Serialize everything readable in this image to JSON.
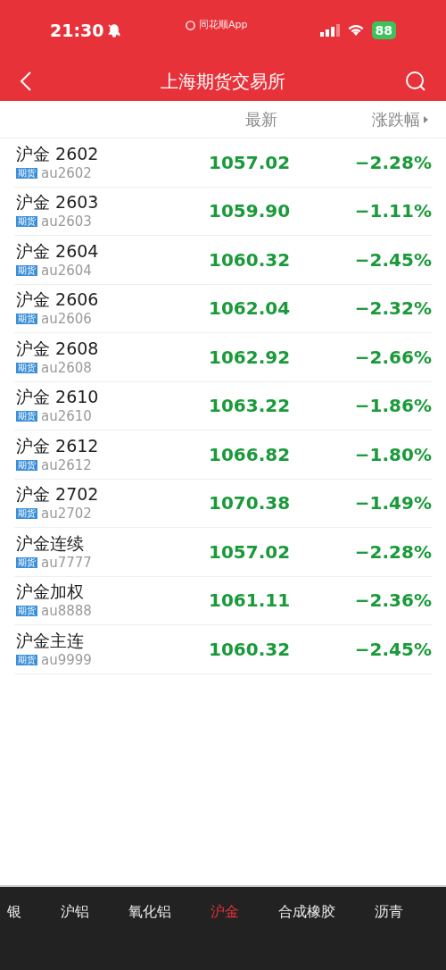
{
  "status_bar": {
    "time": "21:30",
    "app_label": "同花顺App",
    "battery": "88"
  },
  "nav": {
    "title": "上海期货交易所"
  },
  "columns": {
    "latest": "最新",
    "change": "涨跌幅"
  },
  "rows": [
    {
      "name": "沪金 2602",
      "tag": "期货",
      "code": "au2602",
      "price": "1057.02",
      "change": "−2.28%"
    },
    {
      "name": "沪金 2603",
      "tag": "期货",
      "code": "au2603",
      "price": "1059.90",
      "change": "−1.11%"
    },
    {
      "name": "沪金 2604",
      "tag": "期货",
      "code": "au2604",
      "price": "1060.32",
      "change": "−2.45%"
    },
    {
      "name": "沪金 2606",
      "tag": "期货",
      "code": "au2606",
      "price": "1062.04",
      "change": "−2.32%"
    },
    {
      "name": "沪金 2608",
      "tag": "期货",
      "code": "au2608",
      "price": "1062.92",
      "change": "−2.66%"
    },
    {
      "name": "沪金 2610",
      "tag": "期货",
      "code": "au2610",
      "price": "1063.22",
      "change": "−1.86%"
    },
    {
      "name": "沪金 2612",
      "tag": "期货",
      "code": "au2612",
      "price": "1066.82",
      "change": "−1.80%"
    },
    {
      "name": "沪金 2702",
      "tag": "期货",
      "code": "au2702",
      "price": "1070.38",
      "change": "−1.49%"
    },
    {
      "name": "沪金连续",
      "tag": "期货",
      "code": "au7777",
      "price": "1057.02",
      "change": "−2.28%"
    },
    {
      "name": "沪金加权",
      "tag": "期货",
      "code": "au8888",
      "price": "1061.11",
      "change": "−2.36%"
    },
    {
      "name": "沪金主连",
      "tag": "期货",
      "code": "au9999",
      "price": "1060.32",
      "change": "−2.45%"
    }
  ],
  "bottom_tabs": [
    {
      "label": "银",
      "selected": false
    },
    {
      "label": "沪铝",
      "selected": false
    },
    {
      "label": "氧化铝",
      "selected": false
    },
    {
      "label": "沪金",
      "selected": true
    },
    {
      "label": "合成橡胶",
      "selected": false
    },
    {
      "label": "沥青",
      "selected": false
    }
  ]
}
